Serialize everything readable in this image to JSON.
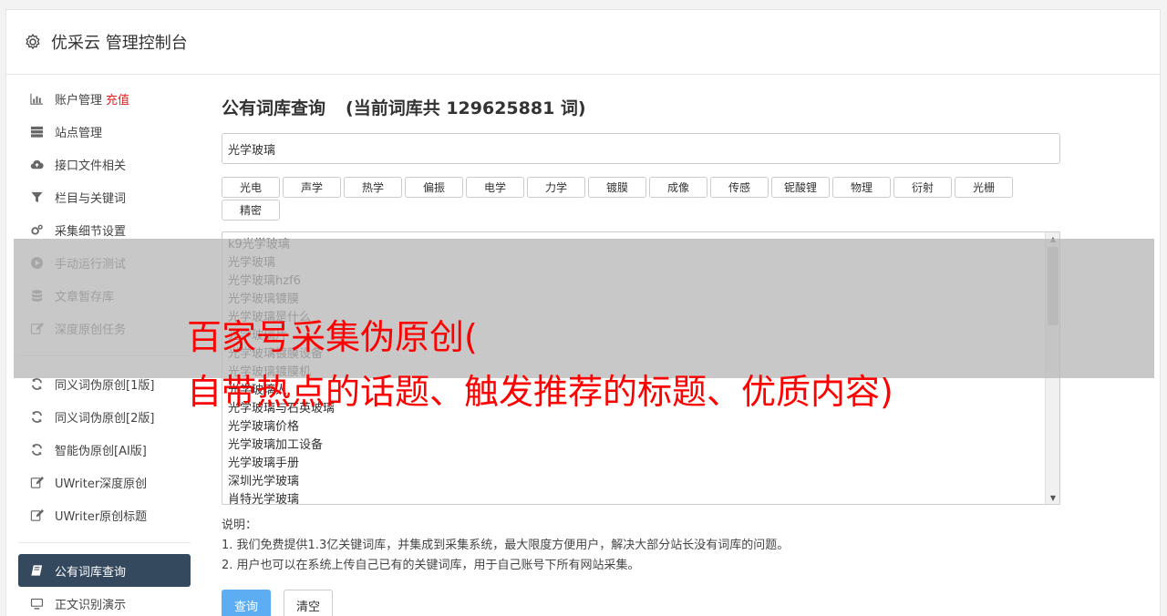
{
  "header": {
    "title": "优采云 管理控制台"
  },
  "sidebar": {
    "group1": [
      {
        "label": "账户管理",
        "extra": "充值",
        "icon": "bar-chart-icon"
      },
      {
        "label": "站点管理",
        "icon": "server-icon"
      },
      {
        "label": "接口文件相关",
        "icon": "cloud-upload-icon"
      },
      {
        "label": "栏目与关键词",
        "icon": "filter-icon"
      },
      {
        "label": "采集细节设置",
        "icon": "gears-icon"
      },
      {
        "label": "手动运行测试",
        "icon": "play-circle-icon"
      },
      {
        "label": "文章暂存库",
        "icon": "database-icon"
      },
      {
        "label": "深度原创任务",
        "icon": "edit-icon"
      }
    ],
    "group2": [
      {
        "label": "同义词伪原创[1版]",
        "icon": "refresh-icon"
      },
      {
        "label": "同义词伪原创[2版]",
        "icon": "refresh-icon"
      },
      {
        "label": "智能伪原创[AI版]",
        "icon": "refresh-icon"
      },
      {
        "label": "UWriter深度原创",
        "icon": "edit-icon"
      },
      {
        "label": "UWriter原创标题",
        "icon": "edit-icon"
      }
    ],
    "group3": [
      {
        "label": "公有词库查询",
        "icon": "book-icon",
        "active": true
      },
      {
        "label": "正文识别演示",
        "icon": "monitor-icon"
      }
    ]
  },
  "main": {
    "title": "公有词库查询",
    "count_text": "(当前词库共 129625881 词)",
    "search_value": "光学玻璃",
    "tags": [
      "光电",
      "声学",
      "热学",
      "偏振",
      "电学",
      "力学",
      "镀膜",
      "成像",
      "传感",
      "铌酸锂",
      "物理",
      "衍射",
      "光栅",
      "精密"
    ],
    "results": [
      "k9光学玻璃",
      "光学玻璃",
      "光学玻璃hzf6",
      "光学玻璃镀膜",
      "光学玻璃是什么",
      "光学玻璃片",
      "光学玻璃镀膜设备",
      "光学玻璃镀膜机",
      "光学玻璃人",
      "光学玻璃与石英玻璃",
      "光学玻璃价格",
      "光学玻璃加工设备",
      "光学玻璃手册",
      "深圳光学玻璃",
      "肖特光学玻璃"
    ],
    "note_title": "说明：",
    "notes": [
      "1. 我们免费提供1.3亿关键词库，并集成到采集系统，最大限度方便用户，解决大部分站长没有词库的问题。",
      "2. 用户也可以在系统上传自己已有的关键词库，用于自己账号下所有网站采集。"
    ],
    "query_button": "查询",
    "clear_button": "清空"
  },
  "overlay": {
    "line1": "百家号采集伪原创(",
    "line2": "自带热点的话题、触发推荐的标题、优质内容)"
  }
}
